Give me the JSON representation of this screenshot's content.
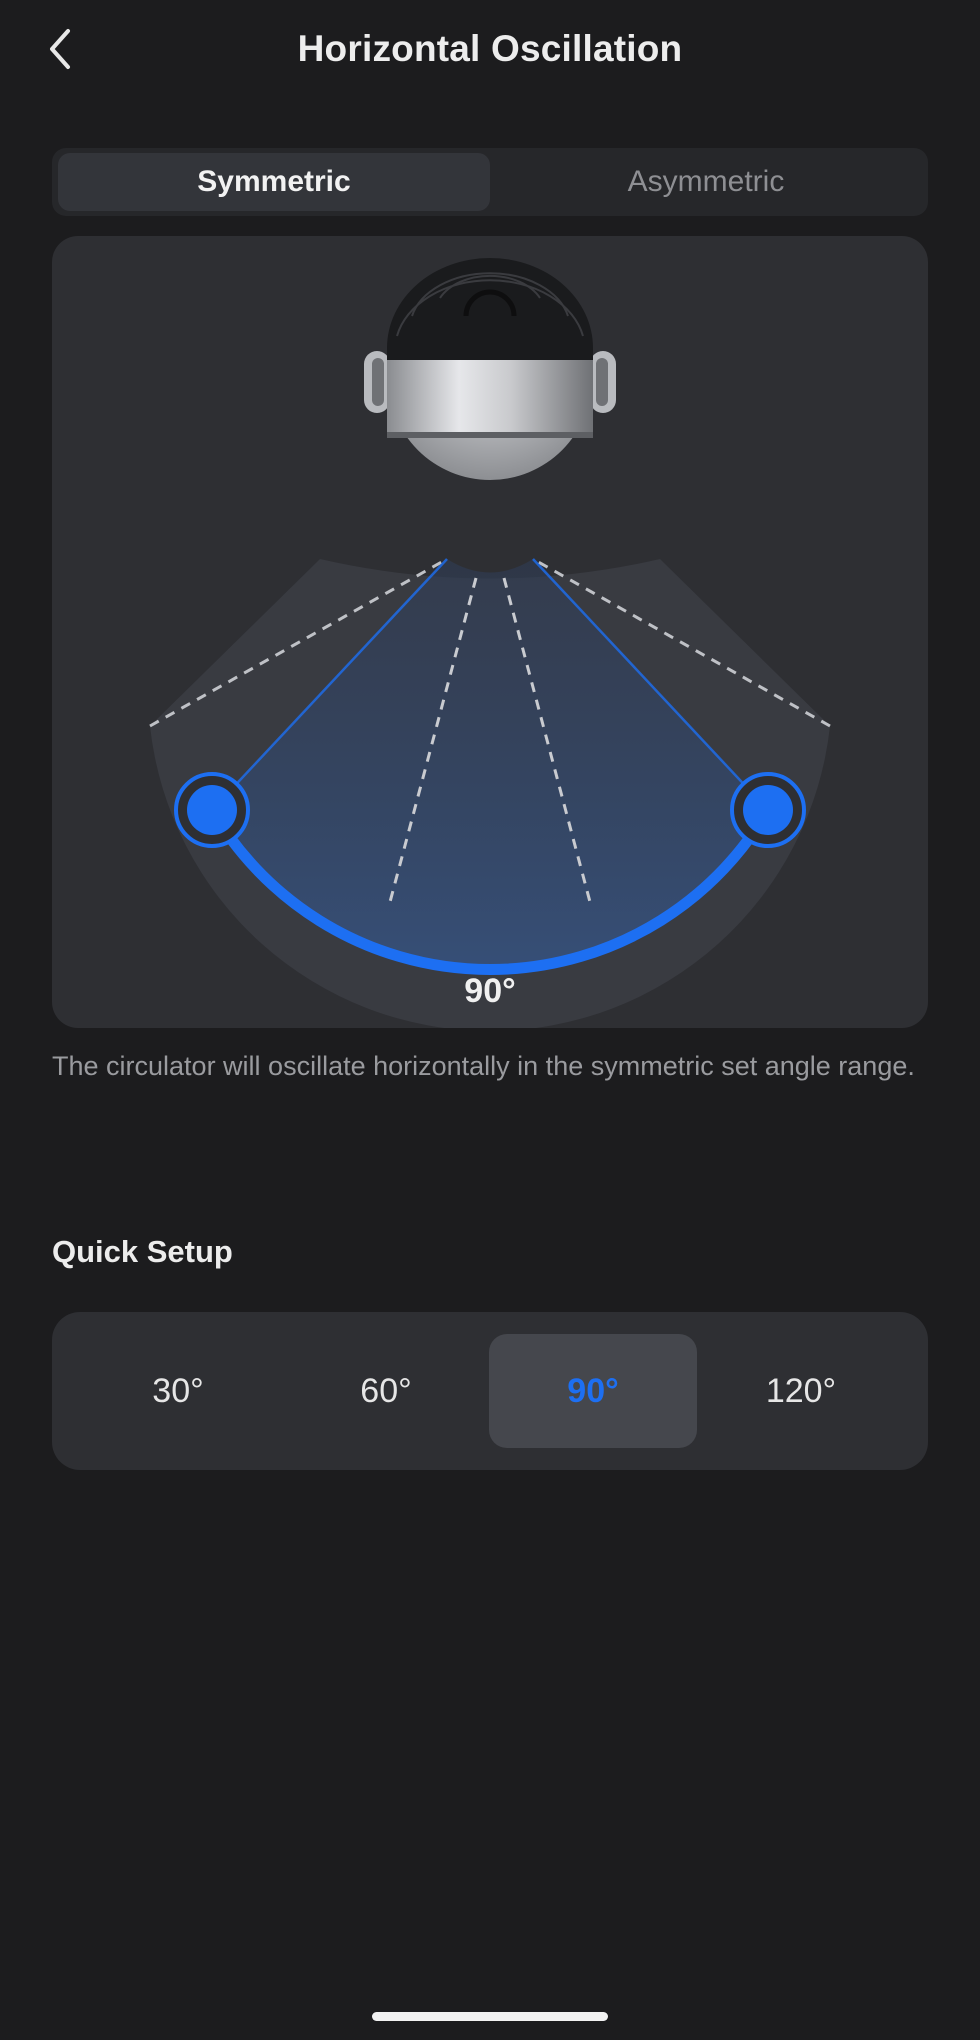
{
  "header": {
    "title": "Horizontal Oscillation",
    "back_icon": "chevron-left-icon"
  },
  "mode_tabs": [
    {
      "label": "Symmetric",
      "active": true
    },
    {
      "label": "Asymmetric",
      "active": false
    }
  ],
  "oscillation": {
    "angle_label": "90°",
    "angle_value": 90,
    "accent_color": "#1d6ff2",
    "device_icon": "fan-circulator-icon"
  },
  "description": "The circulator will oscillate horizontally in the symmetric set angle range.",
  "quick_setup": {
    "title": "Quick Setup",
    "options": [
      "30°",
      "60°",
      "90°",
      "120°"
    ],
    "selected": "90°"
  }
}
